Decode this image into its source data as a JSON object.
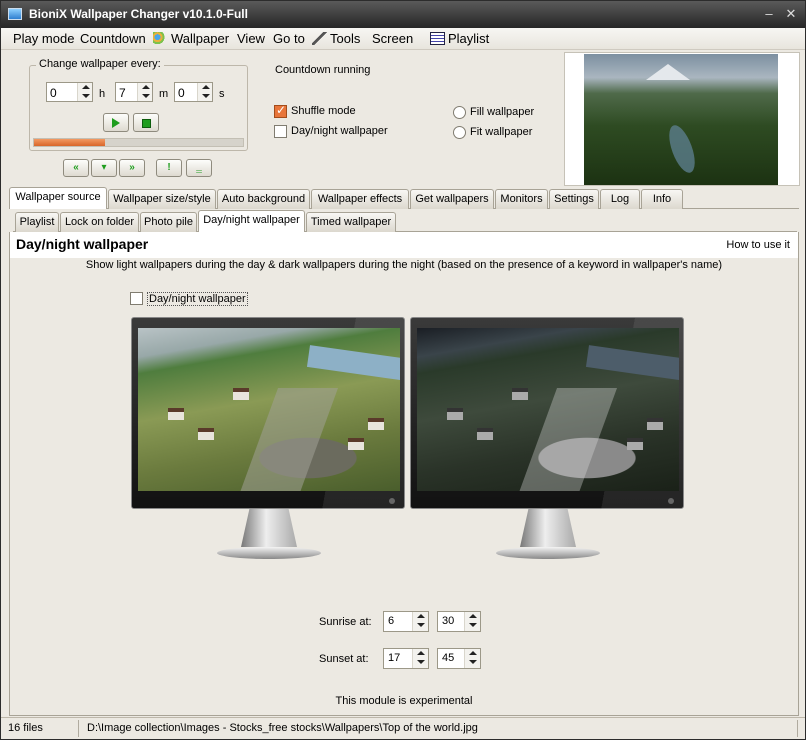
{
  "window": {
    "title": "BioniX Wallpaper Changer v10.1.0-Full",
    "minimize": "‒",
    "close": "✕"
  },
  "menu": [
    "Play mode",
    "Countdown",
    "Wallpaper",
    "View",
    "Go to",
    "Tools",
    "Screen",
    "Playlist"
  ],
  "timer": {
    "group_title": "Change wallpaper every:",
    "hours": "0",
    "hours_unit": "h",
    "minutes": "7",
    "minutes_unit": "m",
    "seconds": "0",
    "seconds_unit": "s",
    "progress": 0.34,
    "nav_buttons": [
      "«",
      "▾",
      "»",
      "!",
      "‗"
    ]
  },
  "status": {
    "countdown": "Countdown running"
  },
  "options": {
    "shuffle": {
      "label": "Shuffle mode",
      "checked": true
    },
    "daynight": {
      "label": "Day/night wallpaper",
      "checked": false
    },
    "fill": {
      "label": "Fill wallpaper"
    },
    "fit": {
      "label": "Fit wallpaper"
    }
  },
  "main_tabs": [
    "Wallpaper source",
    "Wallpaper size/style",
    "Auto background",
    "Wallpaper effects",
    "Get wallpapers",
    "Monitors",
    "Settings",
    "Log",
    "Info"
  ],
  "main_tab_active": 0,
  "sub_tabs": [
    "Playlist",
    "Lock on folder",
    "Photo pile",
    "Day/night wallpaper",
    "Timed wallpaper"
  ],
  "sub_tab_active": 3,
  "page": {
    "title": "Day/night wallpaper",
    "how_to": "How to use it",
    "description": "Show light wallpapers during the day & dark wallpapers during the night (based on the presence of a keyword in wallpaper's name)",
    "enable_label": "Day/night wallpaper",
    "sunrise_label": "Sunrise at:",
    "sunrise_hour": "6",
    "sunrise_minute": "30",
    "sunset_label": "Sunset at:",
    "sunset_hour": "17",
    "sunset_minute": "45",
    "experimental_note": "This module is experimental"
  },
  "statusbar": {
    "files": "16 files",
    "path": "D:\\Image collection\\Images - Stocks_free stocks\\Wallpapers\\Top of the world.jpg"
  },
  "icons": {
    "app": "app-icon",
    "wallpaper": "wallpaper-icon",
    "tools": "tools-icon",
    "playlist": "playlist-icon",
    "play": "play-icon",
    "stop": "stop-icon"
  },
  "colors": {
    "accent": "#e8753a",
    "play": "#1e9d1e",
    "titlebar": "#2e2e2e"
  }
}
